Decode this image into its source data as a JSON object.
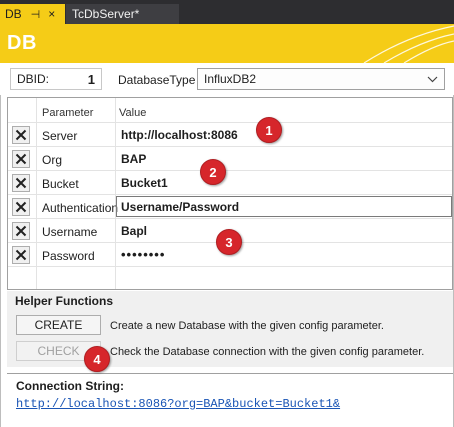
{
  "tabs": {
    "active_label": "DB",
    "pin_glyph": "⊣",
    "close_glyph": "×",
    "inactive_label": "TcDbServer*"
  },
  "banner": {
    "title": "DB"
  },
  "config": {
    "dbid_label": "DBID:",
    "dbid_value": "1",
    "dbtype_label": "DatabaseType",
    "dbtype_value": "InfluxDB2"
  },
  "grid": {
    "col_parameter": "Parameter",
    "col_value": "Value",
    "rows": [
      {
        "name": "Server",
        "value": "http://localhost:8086"
      },
      {
        "name": "Org",
        "value": "BAP"
      },
      {
        "name": "Bucket",
        "value": "Bucket1"
      },
      {
        "name": "Authentication",
        "value": "Username/Password"
      },
      {
        "name": "Username",
        "value": "Bapl"
      },
      {
        "name": "Password",
        "value": "••••••••"
      }
    ]
  },
  "helper": {
    "title": "Helper Functions",
    "create_label": "CREATE",
    "create_desc": "Create a new Database with the given config parameter.",
    "check_label": "CHECK",
    "check_desc": "Check the Database connection with the given config parameter."
  },
  "connection": {
    "label": "Connection String:",
    "value": "http://localhost:8086?org=BAP&bucket=Bucket1&"
  },
  "callouts": [
    "1",
    "2",
    "3",
    "4"
  ],
  "colors": {
    "accent_yellow": "#f5cc17",
    "callout_red": "#d6262b",
    "link_blue": "#1a55b5",
    "tab_dark": "#2d2d30"
  }
}
